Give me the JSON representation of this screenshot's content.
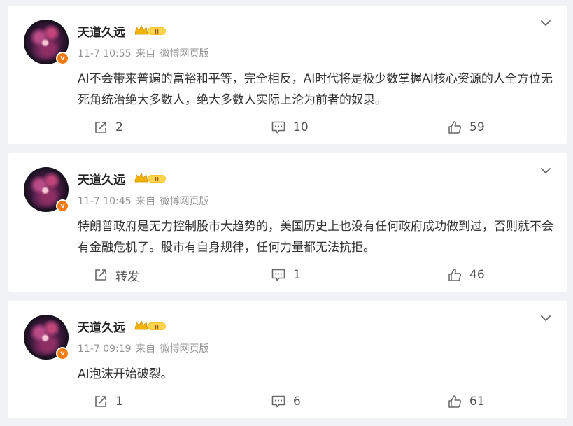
{
  "posts": [
    {
      "username": "天道久远",
      "level_badge": "II",
      "verified_badge": "v",
      "time": "11-7 10:55",
      "source_prefix": "来自",
      "source": "微博网页版",
      "text": "AI不会带来普遍的富裕和平等，完全相反，AI时代将是极少数掌握AI核心资源的人全方位无死角统治绝大多数人，绝大多数人实际上沦为前者的奴隶。",
      "shares": "2",
      "comments": "10",
      "likes": "59"
    },
    {
      "username": "天道久远",
      "level_badge": "II",
      "verified_badge": "v",
      "time": "11-7 10:45",
      "source_prefix": "来自",
      "source": "微博网页版",
      "text": "特朗普政府是无力控制股市大趋势的，美国历史上也没有任何政府成功做到过，否则就不会有金融危机了。股市有自身规律，任何力量都无法抗拒。",
      "shares": "转发",
      "comments": "1",
      "likes": "46"
    },
    {
      "username": "天道久远",
      "level_badge": "II",
      "verified_badge": "v",
      "time": "11-7 09:19",
      "source_prefix": "来自",
      "source": "微博网页版",
      "text": "AI泡沫开始破裂。",
      "shares": "1",
      "comments": "6",
      "likes": "61"
    }
  ],
  "icons": {
    "share": "share-icon",
    "comment": "comment-icon",
    "like": "like-icon",
    "menu": "chevron-down-icon",
    "crown": "crown-level-badge-icon"
  },
  "colors": {
    "background": "#f1f2f5",
    "card": "#ffffff",
    "verified": "#f77a0c",
    "badge_gold": "#f0b400",
    "meta_gray": "#939393"
  }
}
